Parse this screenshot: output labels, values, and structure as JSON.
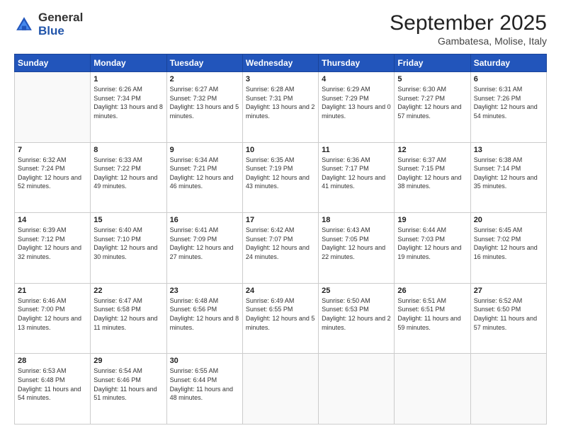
{
  "logo": {
    "general": "General",
    "blue": "Blue"
  },
  "header": {
    "month": "September 2025",
    "location": "Gambatesa, Molise, Italy"
  },
  "days_of_week": [
    "Sunday",
    "Monday",
    "Tuesday",
    "Wednesday",
    "Thursday",
    "Friday",
    "Saturday"
  ],
  "weeks": [
    [
      {
        "day": "",
        "sunrise": "",
        "sunset": "",
        "daylight": ""
      },
      {
        "day": "1",
        "sunrise": "Sunrise: 6:26 AM",
        "sunset": "Sunset: 7:34 PM",
        "daylight": "Daylight: 13 hours and 8 minutes."
      },
      {
        "day": "2",
        "sunrise": "Sunrise: 6:27 AM",
        "sunset": "Sunset: 7:32 PM",
        "daylight": "Daylight: 13 hours and 5 minutes."
      },
      {
        "day": "3",
        "sunrise": "Sunrise: 6:28 AM",
        "sunset": "Sunset: 7:31 PM",
        "daylight": "Daylight: 13 hours and 2 minutes."
      },
      {
        "day": "4",
        "sunrise": "Sunrise: 6:29 AM",
        "sunset": "Sunset: 7:29 PM",
        "daylight": "Daylight: 13 hours and 0 minutes."
      },
      {
        "day": "5",
        "sunrise": "Sunrise: 6:30 AM",
        "sunset": "Sunset: 7:27 PM",
        "daylight": "Daylight: 12 hours and 57 minutes."
      },
      {
        "day": "6",
        "sunrise": "Sunrise: 6:31 AM",
        "sunset": "Sunset: 7:26 PM",
        "daylight": "Daylight: 12 hours and 54 minutes."
      }
    ],
    [
      {
        "day": "7",
        "sunrise": "Sunrise: 6:32 AM",
        "sunset": "Sunset: 7:24 PM",
        "daylight": "Daylight: 12 hours and 52 minutes."
      },
      {
        "day": "8",
        "sunrise": "Sunrise: 6:33 AM",
        "sunset": "Sunset: 7:22 PM",
        "daylight": "Daylight: 12 hours and 49 minutes."
      },
      {
        "day": "9",
        "sunrise": "Sunrise: 6:34 AM",
        "sunset": "Sunset: 7:21 PM",
        "daylight": "Daylight: 12 hours and 46 minutes."
      },
      {
        "day": "10",
        "sunrise": "Sunrise: 6:35 AM",
        "sunset": "Sunset: 7:19 PM",
        "daylight": "Daylight: 12 hours and 43 minutes."
      },
      {
        "day": "11",
        "sunrise": "Sunrise: 6:36 AM",
        "sunset": "Sunset: 7:17 PM",
        "daylight": "Daylight: 12 hours and 41 minutes."
      },
      {
        "day": "12",
        "sunrise": "Sunrise: 6:37 AM",
        "sunset": "Sunset: 7:15 PM",
        "daylight": "Daylight: 12 hours and 38 minutes."
      },
      {
        "day": "13",
        "sunrise": "Sunrise: 6:38 AM",
        "sunset": "Sunset: 7:14 PM",
        "daylight": "Daylight: 12 hours and 35 minutes."
      }
    ],
    [
      {
        "day": "14",
        "sunrise": "Sunrise: 6:39 AM",
        "sunset": "Sunset: 7:12 PM",
        "daylight": "Daylight: 12 hours and 32 minutes."
      },
      {
        "day": "15",
        "sunrise": "Sunrise: 6:40 AM",
        "sunset": "Sunset: 7:10 PM",
        "daylight": "Daylight: 12 hours and 30 minutes."
      },
      {
        "day": "16",
        "sunrise": "Sunrise: 6:41 AM",
        "sunset": "Sunset: 7:09 PM",
        "daylight": "Daylight: 12 hours and 27 minutes."
      },
      {
        "day": "17",
        "sunrise": "Sunrise: 6:42 AM",
        "sunset": "Sunset: 7:07 PM",
        "daylight": "Daylight: 12 hours and 24 minutes."
      },
      {
        "day": "18",
        "sunrise": "Sunrise: 6:43 AM",
        "sunset": "Sunset: 7:05 PM",
        "daylight": "Daylight: 12 hours and 22 minutes."
      },
      {
        "day": "19",
        "sunrise": "Sunrise: 6:44 AM",
        "sunset": "Sunset: 7:03 PM",
        "daylight": "Daylight: 12 hours and 19 minutes."
      },
      {
        "day": "20",
        "sunrise": "Sunrise: 6:45 AM",
        "sunset": "Sunset: 7:02 PM",
        "daylight": "Daylight: 12 hours and 16 minutes."
      }
    ],
    [
      {
        "day": "21",
        "sunrise": "Sunrise: 6:46 AM",
        "sunset": "Sunset: 7:00 PM",
        "daylight": "Daylight: 12 hours and 13 minutes."
      },
      {
        "day": "22",
        "sunrise": "Sunrise: 6:47 AM",
        "sunset": "Sunset: 6:58 PM",
        "daylight": "Daylight: 12 hours and 11 minutes."
      },
      {
        "day": "23",
        "sunrise": "Sunrise: 6:48 AM",
        "sunset": "Sunset: 6:56 PM",
        "daylight": "Daylight: 12 hours and 8 minutes."
      },
      {
        "day": "24",
        "sunrise": "Sunrise: 6:49 AM",
        "sunset": "Sunset: 6:55 PM",
        "daylight": "Daylight: 12 hours and 5 minutes."
      },
      {
        "day": "25",
        "sunrise": "Sunrise: 6:50 AM",
        "sunset": "Sunset: 6:53 PM",
        "daylight": "Daylight: 12 hours and 2 minutes."
      },
      {
        "day": "26",
        "sunrise": "Sunrise: 6:51 AM",
        "sunset": "Sunset: 6:51 PM",
        "daylight": "Daylight: 11 hours and 59 minutes."
      },
      {
        "day": "27",
        "sunrise": "Sunrise: 6:52 AM",
        "sunset": "Sunset: 6:50 PM",
        "daylight": "Daylight: 11 hours and 57 minutes."
      }
    ],
    [
      {
        "day": "28",
        "sunrise": "Sunrise: 6:53 AM",
        "sunset": "Sunset: 6:48 PM",
        "daylight": "Daylight: 11 hours and 54 minutes."
      },
      {
        "day": "29",
        "sunrise": "Sunrise: 6:54 AM",
        "sunset": "Sunset: 6:46 PM",
        "daylight": "Daylight: 11 hours and 51 minutes."
      },
      {
        "day": "30",
        "sunrise": "Sunrise: 6:55 AM",
        "sunset": "Sunset: 6:44 PM",
        "daylight": "Daylight: 11 hours and 48 minutes."
      },
      {
        "day": "",
        "sunrise": "",
        "sunset": "",
        "daylight": ""
      },
      {
        "day": "",
        "sunrise": "",
        "sunset": "",
        "daylight": ""
      },
      {
        "day": "",
        "sunrise": "",
        "sunset": "",
        "daylight": ""
      },
      {
        "day": "",
        "sunrise": "",
        "sunset": "",
        "daylight": ""
      }
    ]
  ]
}
